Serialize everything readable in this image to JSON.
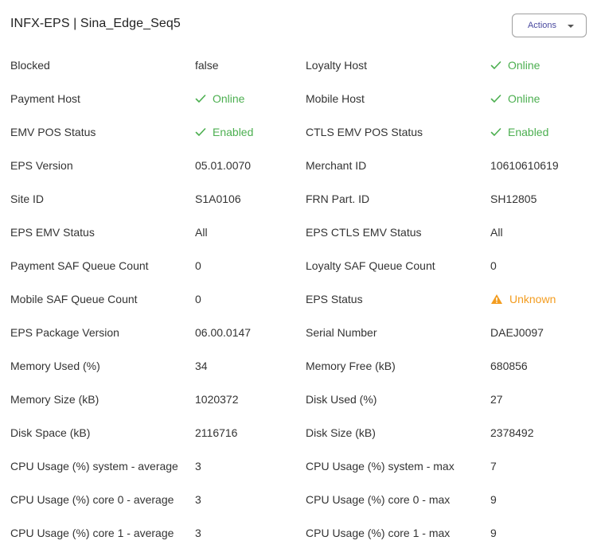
{
  "header": {
    "title": "INFX-EPS | Sina_Edge_Seq5",
    "actions_label": "Actions"
  },
  "colors": {
    "ok": "#4caf50",
    "warn": "#f39c1f"
  },
  "rows": [
    {
      "l1": "Blocked",
      "v1": "false",
      "l2": "Loyalty Host",
      "v2": "Online",
      "v2_status": "ok"
    },
    {
      "l1": "Payment Host",
      "v1": "Online",
      "v1_status": "ok",
      "l2": "Mobile Host",
      "v2": "Online",
      "v2_status": "ok"
    },
    {
      "l1": "EMV POS Status",
      "v1": "Enabled",
      "v1_status": "ok",
      "l2": "CTLS EMV POS Status",
      "v2": "Enabled",
      "v2_status": "ok"
    },
    {
      "l1": "EPS Version",
      "v1": "05.01.0070",
      "l2": "Merchant ID",
      "v2": "10610610619"
    },
    {
      "l1": "Site ID",
      "v1": "S1A0106",
      "l2": "FRN Part. ID",
      "v2": "SH12805"
    },
    {
      "l1": "EPS EMV Status",
      "v1": "All",
      "l2": "EPS CTLS EMV Status",
      "v2": "All"
    },
    {
      "l1": "Payment SAF Queue Count",
      "v1": "0",
      "l2": "Loyalty SAF Queue Count",
      "v2": "0"
    },
    {
      "l1": "Mobile SAF Queue Count",
      "v1": "0",
      "l2": "EPS Status",
      "v2": "Unknown",
      "v2_status": "warn"
    },
    {
      "l1": "EPS Package Version",
      "v1": "06.00.0147",
      "l2": "Serial Number",
      "v2": "DAEJ0097"
    },
    {
      "l1": "Memory Used (%)",
      "v1": "34",
      "l2": "Memory Free (kB)",
      "v2": "680856"
    },
    {
      "l1": "Memory Size (kB)",
      "v1": "1020372",
      "l2": "Disk Used (%)",
      "v2": "27"
    },
    {
      "l1": "Disk Space (kB)",
      "v1": "2116716",
      "l2": "Disk Size (kB)",
      "v2": "2378492"
    },
    {
      "l1": "CPU Usage (%) system - average",
      "v1": "3",
      "l2": "CPU Usage (%) system - max",
      "v2": "7"
    },
    {
      "l1": "CPU Usage (%) core 0 - average",
      "v1": "3",
      "l2": "CPU Usage (%) core 0 - max",
      "v2": "9"
    },
    {
      "l1": "CPU Usage (%) core 1 - average",
      "v1": "3",
      "l2": "CPU Usage (%) core 1 - max",
      "v2": "9"
    }
  ]
}
